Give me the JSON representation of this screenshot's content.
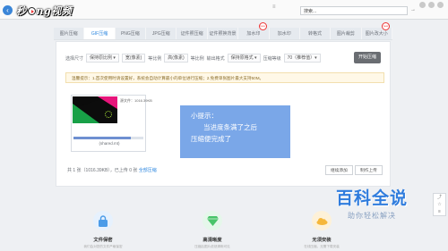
{
  "browser": {
    "back_icon": "back-arrow-icon",
    "address_text": "搜索...",
    "logo_text_left": "秒",
    "logo_text_right": "ng视频",
    "go_icon": "forward-arrow-icon"
  },
  "tabs": [
    {
      "label": "图片压缩",
      "active": false,
      "badge": ""
    },
    {
      "label": "GIF压缩",
      "active": true,
      "badge": ""
    },
    {
      "label": "PNG压缩",
      "active": false,
      "badge": ""
    },
    {
      "label": "JPG压缩",
      "active": false,
      "badge": ""
    },
    {
      "label": "证件照压缩",
      "active": false,
      "badge": ""
    },
    {
      "label": "证件照换背景",
      "active": false,
      "badge": ""
    },
    {
      "label": "加水印",
      "active": false,
      "badge": "new"
    },
    {
      "label": "加水印",
      "active": false,
      "badge": ""
    },
    {
      "label": "转格式",
      "active": false,
      "badge": ""
    },
    {
      "label": "图片裁剪",
      "active": false,
      "badge": ""
    },
    {
      "label": "图片改大小",
      "active": false,
      "badge": "new"
    }
  ],
  "options": {
    "size_label": "选择尺寸",
    "size_value": "保持原比例 ▾",
    "width_value": "宽(像素)",
    "height_value": "高(像素)",
    "ratio_label1": "等比例",
    "ratio_label2": "等比例",
    "format_label": "输出格式",
    "format_value": "保持原格式 ▾",
    "level_label": "压缩等级",
    "level_value": "70（推荐值）▾",
    "start_button": "开始压缩"
  },
  "notice": "温馨提示：1.首次使用时请设置好，系统会自动计算最小的单位进行压缩；2.免费单张图片最大支持50M。",
  "file": {
    "name": "源文件：1016.39KB",
    "caption": "(shared.mt)",
    "progress": 0.82
  },
  "tip": {
    "line1": "小提示：",
    "line2": "当进度条满了之后",
    "line3": "压缩便完成了"
  },
  "footer": {
    "count_text": "共 1 张（1016.39KB），已上传 0 张",
    "all_compress_link": "全部压缩",
    "continue_button": "继续添加",
    "download_button": "制作上传"
  },
  "features": [
    {
      "title": "文件保密",
      "desc": "我们会对您的文件严格保密",
      "icon": "lock-icon",
      "color": "#4a9be8"
    },
    {
      "title": "高清晰度",
      "desc": "压缩后图片依然清晰可见",
      "icon": "diamond-icon",
      "color": "#49c46a"
    },
    {
      "title": "无须安装",
      "desc": "在线压缩，无需下载安装",
      "icon": "cloud-icon",
      "color": "#f5b73b"
    }
  ],
  "watermark": {
    "main": "百科全说",
    "sub": "助你轻松解决"
  },
  "side_tools": [
    "⤴",
    "☆",
    "≡"
  ]
}
